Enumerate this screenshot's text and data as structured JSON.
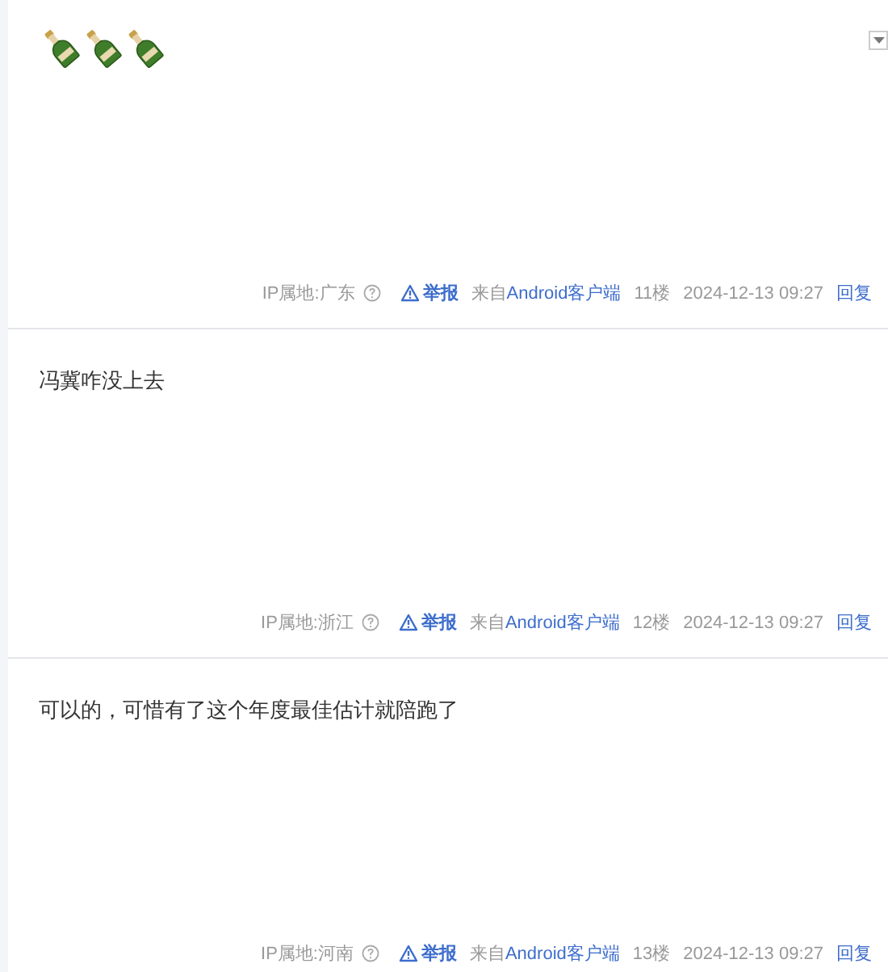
{
  "posts": [
    {
      "has_menu": true,
      "emojis": [
        {
          "kind": "bottle"
        },
        {
          "kind": "bottle"
        },
        {
          "kind": "bottle"
        }
      ],
      "ip": "IP属地:广东",
      "report": "举报",
      "source_prefix": "来自",
      "source_link": "Android客户端",
      "floor": "11楼",
      "time": "2024-12-13 09:27",
      "reply": "回复"
    },
    {
      "has_menu": false,
      "text": "冯冀咋没上去",
      "ip": "IP属地:浙江",
      "report": "举报",
      "source_prefix": "来自",
      "source_link": "Android客户端",
      "floor": "12楼",
      "time": "2024-12-13 09:27",
      "reply": "回复"
    },
    {
      "has_menu": false,
      "text": "可以的，可惜有了这个年度最佳估计就陪跑了",
      "ip": "IP属地:河南",
      "report": "举报",
      "source_prefix": "来自",
      "source_link": "Android客户端",
      "floor": "13楼",
      "time": "2024-12-13 09:27",
      "reply": "回复"
    }
  ]
}
